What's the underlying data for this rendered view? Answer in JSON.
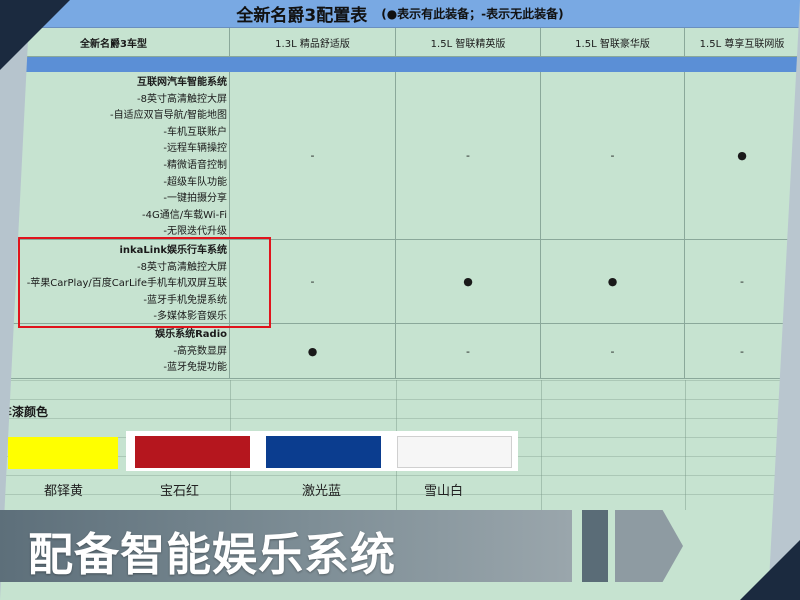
{
  "title": {
    "main": "全新名爵3配置表",
    "note": "(●表示有此装备；-表示无此装备)"
  },
  "header": {
    "model_label": "全新名爵3车型",
    "columns": [
      "1.3L 精品舒适版",
      "1.5L 智联精英版",
      "1.5L 智联豪华版",
      "1.5L 尊享互联网版"
    ]
  },
  "features": [
    {
      "title": "互联网汽车智能系统",
      "items": [
        "-8英寸高清触控大屏",
        "-自适应双盲导航/智能地图",
        "-车机互联账户",
        "-远程车辆操控",
        "-精微语音控制",
        "-超级车队功能",
        "-一键拍摄分享",
        "-4G通信/车载Wi-Fi",
        "-无限迭代升级"
      ],
      "values": [
        "-",
        "-",
        "-",
        "●"
      ]
    },
    {
      "title": "inkaLink娱乐行车系统",
      "items": [
        "-8英寸高清触控大屏",
        "-苹果CarPlay/百度CarLife手机车机双屏互联",
        "-蓝牙手机免提系统",
        "-多媒体影音娱乐"
      ],
      "values": [
        "-",
        "●",
        "●",
        "-"
      ]
    },
    {
      "title": "娱乐系统Radio",
      "items": [
        "-高亮数显屏",
        "-蓝牙免提功能"
      ],
      "values": [
        "●",
        "-",
        "-",
        "-"
      ]
    }
  ],
  "paint": {
    "heading": "车漆颜色",
    "colors": [
      {
        "name": "都铎黄",
        "hex": "#ffff00"
      },
      {
        "name": "宝石红",
        "hex": "#b5161e"
      },
      {
        "name": "激光蓝",
        "hex": "#0b3d8f"
      },
      {
        "name": "雪山白",
        "hex": "#f6f6f6"
      }
    ]
  },
  "banner": {
    "text": "配备智能娱乐系统"
  },
  "colors": {
    "title_bar": "#79a9e3",
    "strip": "#5b8fd6",
    "table_bg": "#c6e3d0",
    "highlight": "#e0141c"
  }
}
